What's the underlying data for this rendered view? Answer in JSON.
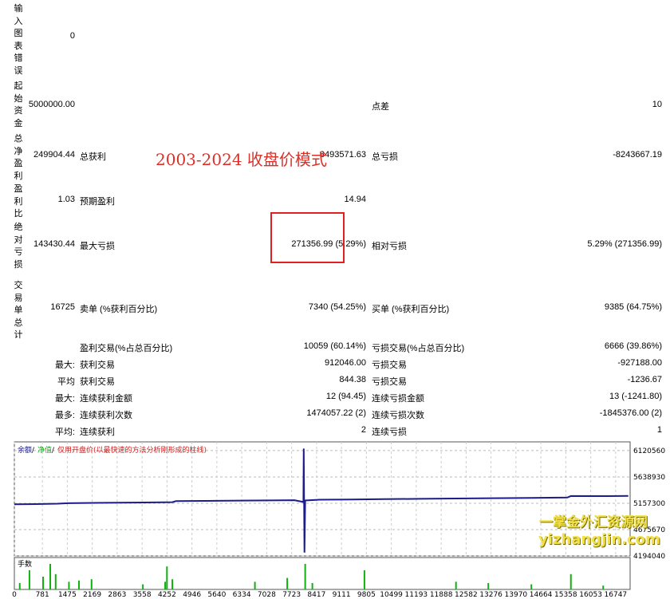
{
  "side_labels": {
    "input_chart_errors": "输入图表错误",
    "initial_deposit": "起始资金",
    "total_net_profit": "总净盈利",
    "profit_factor": "盈利比",
    "abs_drawdown": "绝对亏损",
    "total_trades": "交易单总计"
  },
  "values": {
    "chart_errors": "0",
    "initial_deposit": "5000000.00",
    "net_profit": "249904.44",
    "profit_factor": "1.03",
    "abs_drawdown": "143430.44",
    "total_trades": "16725"
  },
  "report": {
    "spread_label": "点差",
    "spread_value": "10",
    "gross_profit_label": "总获利",
    "gross_profit_value": "8493571.63",
    "gross_loss_label": "总亏损",
    "gross_loss_value": "-8243667.19",
    "expected_payoff_label": "预期盈利",
    "expected_payoff_value": "14.94",
    "max_drawdown_label": "最大亏损",
    "max_drawdown_value": "271356.99 (5.29%)",
    "rel_drawdown_label": "相对亏损",
    "rel_drawdown_value": "5.29% (271356.99)",
    "short_label": "卖单 (%获利百分比)",
    "short_value": "7340 (54.25%)",
    "long_label": "买单 (%获利百分比)",
    "long_value": "9385 (64.75%)",
    "profit_trades_label": "盈利交易(%占总百分比)",
    "profit_trades_value": "10059 (60.14%)",
    "loss_trades_label": "亏损交易(%占总百分比)",
    "loss_trades_value": "6666 (39.86%)",
    "largest_prefix": "最大:",
    "largest_profit_label": "获利交易",
    "largest_profit_value": "912046.00",
    "largest_loss_label": "亏损交易",
    "largest_loss_value": "-927188.00",
    "average_prefix": "平均",
    "avg_profit_label": "获利交易",
    "avg_profit_value": "844.38",
    "avg_loss_label": "亏损交易",
    "avg_loss_value": "-1236.67",
    "max_prefix": "最大:",
    "max_consec_wins_label": "连续获利金额",
    "max_consec_wins_value": "12 (94.45)",
    "max_consec_losses_label": "连续亏损金额",
    "max_consec_losses_value": "13 (-1241.80)",
    "maximal_prefix": "最多:",
    "maximal_consec_profit_label": "连续获利次数",
    "maximal_consec_profit_value": "1474057.22 (2)",
    "maximal_consec_loss_label": "连续亏损次数",
    "maximal_consec_loss_value": "-1845376.00 (2)",
    "avg_prefix2": "平均:",
    "avg_consec_wins_label": "连续获利",
    "avg_consec_wins_value": "2",
    "avg_consec_losses_label": "连续亏损",
    "avg_consec_losses_value": "1"
  },
  "overlay_text": "2003-2024 收盘价模式",
  "watermark": {
    "line1": "一掌金外汇资源网",
    "line2": "yizhangjin.com"
  },
  "colors": {
    "balance_line": "#1c1c8c",
    "volume_bars": "#10b010",
    "legend_balance": "#1c1c8c",
    "legend_equity": "#10b010",
    "legend_note": "#d02020",
    "highlight_box": "#e02020",
    "overlay_text": "#d9302a"
  },
  "chart_data": {
    "type": "line",
    "legend": {
      "balance": "余额",
      "equity": "净值",
      "note": "仅用开盘价(以最快速的方法分析刚形成的柱线)"
    },
    "volume_label": "手数",
    "y_ticks": [
      "6120560",
      "5638930",
      "5157300",
      "4675670",
      "4194040"
    ],
    "ylim": [
      4194040,
      6280000
    ],
    "x_ticks": [
      "0",
      "781",
      "1475",
      "2169",
      "2863",
      "3558",
      "4252",
      "4946",
      "5640",
      "6334",
      "7028",
      "7723",
      "8417",
      "9111",
      "9805",
      "10499",
      "11193",
      "11888",
      "12582",
      "13276",
      "13970",
      "14664",
      "15358",
      "16053",
      "16747"
    ],
    "xlim": [
      0,
      17150
    ],
    "series": [
      {
        "x": [
          0,
          600,
          1200,
          1500,
          2500,
          3600,
          4400,
          4500,
          5300,
          6300,
          7100,
          7800,
          8050,
          8060,
          8080,
          8100,
          8500,
          9400,
          10300,
          11300,
          12300,
          13300,
          14400,
          15400,
          15500,
          16500,
          17100
        ],
        "y": [
          5138000,
          5142000,
          5150000,
          5158000,
          5165000,
          5171000,
          5177000,
          5196000,
          5200000,
          5206000,
          5210000,
          5214000,
          5180000,
          6158000,
          4255000,
          5208000,
          5222000,
          5226000,
          5232000,
          5238000,
          5244000,
          5250000,
          5256000,
          5262000,
          5290000,
          5288000,
          5292000
        ]
      }
    ],
    "volume_bars": [
      {
        "x": 150,
        "v": 0.25
      },
      {
        "x": 420,
        "v": 0.75
      },
      {
        "x": 800,
        "v": 0.5
      },
      {
        "x": 1000,
        "v": 1.0
      },
      {
        "x": 1150,
        "v": 0.6
      },
      {
        "x": 1520,
        "v": 0.3
      },
      {
        "x": 1800,
        "v": 0.35
      },
      {
        "x": 2150,
        "v": 0.4
      },
      {
        "x": 3580,
        "v": 0.2
      },
      {
        "x": 4200,
        "v": 0.3
      },
      {
        "x": 4250,
        "v": 0.9
      },
      {
        "x": 4400,
        "v": 0.4
      },
      {
        "x": 6700,
        "v": 0.3
      },
      {
        "x": 7600,
        "v": 0.45
      },
      {
        "x": 8100,
        "v": 1.0
      },
      {
        "x": 8300,
        "v": 0.25
      },
      {
        "x": 9750,
        "v": 0.75
      },
      {
        "x": 12300,
        "v": 0.3
      },
      {
        "x": 13200,
        "v": 0.25
      },
      {
        "x": 14400,
        "v": 0.2
      },
      {
        "x": 15500,
        "v": 0.6
      },
      {
        "x": 16400,
        "v": 0.15
      }
    ]
  }
}
